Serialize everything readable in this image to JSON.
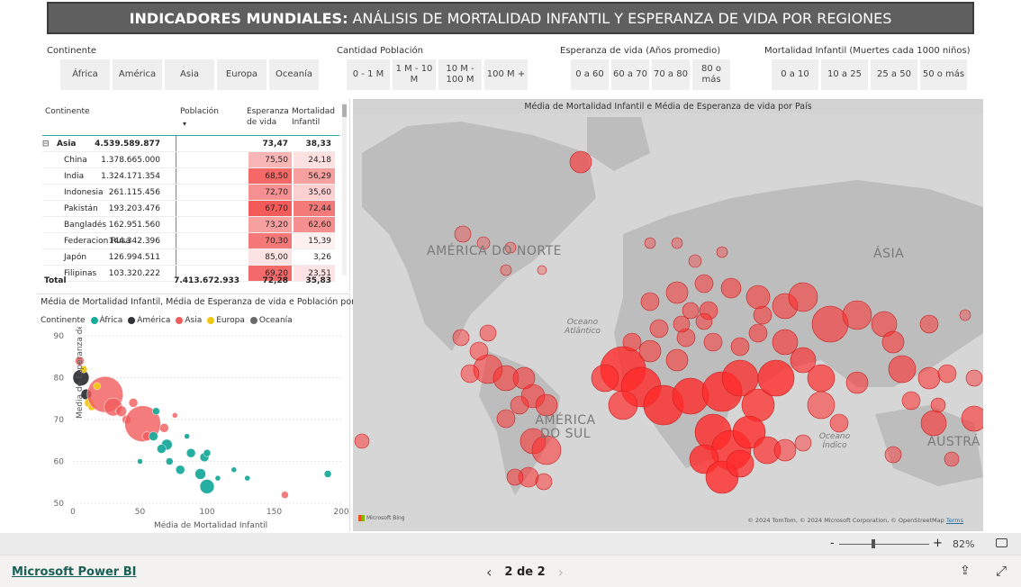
{
  "banner": {
    "bold": "INDICADORES MUNDIALES:",
    "rest": "ANÁLISIS DE MORTALIDAD INFANTIL Y ESPERANZA DE VIDA POR REGIONES"
  },
  "slicers": {
    "continente": {
      "title": "Continente",
      "options": [
        "África",
        "América",
        "Asia",
        "Europa",
        "Oceanía"
      ]
    },
    "poblacion": {
      "title": "Cantidad Población",
      "options": [
        "0 - 1 M",
        "1 M - 10 M",
        "10 M - 100 M",
        "100 M +"
      ]
    },
    "esperanza": {
      "title": "Esperanza de vida (Años promedio)",
      "options": [
        "0 a 60",
        "60 a 70",
        "70 a 80",
        "80 o más"
      ]
    },
    "mortalidad": {
      "title": "Mortalidad Infantil (Muertes cada 1000 niños)",
      "options": [
        "0 a 10",
        "10 a 25",
        "25 a 50",
        "50 o más"
      ]
    }
  },
  "table": {
    "headers": {
      "continente": "Continente",
      "poblacion": "Población",
      "esperanza": "Esperanza de vida",
      "mortalidad": "Mortalidad Infantil"
    },
    "group": {
      "expand": "⊟",
      "name": "Asia",
      "poblacion": "4.539.589.877",
      "esperanza": "73,47",
      "mortalidad": "38,33"
    },
    "rows": [
      {
        "pais": "China",
        "poblacion": "1.378.665.000",
        "esperanza": "75,50",
        "mortalidad": "24,18"
      },
      {
        "pais": "India",
        "poblacion": "1.324.171.354",
        "esperanza": "68,50",
        "mortalidad": "56,29"
      },
      {
        "pais": "Indonesia",
        "poblacion": "261.115.456",
        "esperanza": "72,70",
        "mortalidad": "35,60"
      },
      {
        "pais": "Pakistán",
        "poblacion": "193.203.476",
        "esperanza": "67,70",
        "mortalidad": "72,44"
      },
      {
        "pais": "Bangladés",
        "poblacion": "162.951.560",
        "esperanza": "73,20",
        "mortalidad": "62,60"
      },
      {
        "pais": "Federacion Rusa",
        "poblacion": "144.342.396",
        "esperanza": "70,30",
        "mortalidad": "15,39"
      },
      {
        "pais": "Japón",
        "poblacion": "126.994.511",
        "esperanza": "85,00",
        "mortalidad": "3,26"
      },
      {
        "pais": "Filipinas",
        "poblacion": "103.320.222",
        "esperanza": "69,20",
        "mortalidad": "23,51"
      }
    ],
    "total": {
      "label": "Total",
      "poblacion": "7.413.672.933",
      "esperanza": "72,28",
      "mortalidad": "35,83"
    }
  },
  "scatter": {
    "title": "Média de Mortalidad Infantil, Média de Esperanza de vida e Población por P...",
    "legend_title": "Continente",
    "legend": [
      {
        "name": "África",
        "color": "#1aab9b"
      },
      {
        "name": "América",
        "color": "#2f3436"
      },
      {
        "name": "Asia",
        "color": "#f25b5b"
      },
      {
        "name": "Europa",
        "color": "#f2c811"
      },
      {
        "name": "Oceanía",
        "color": "#6a6a6a"
      }
    ],
    "xlabel": "Média de Mortalidad Infantil",
    "ylabel": "Media de Esperanza de vida",
    "xticks": [
      "0",
      "50",
      "100",
      "150",
      "200"
    ],
    "yticks": [
      "90",
      "80",
      "70",
      "60",
      "50"
    ]
  },
  "map": {
    "title": "Média de Mortalidad Infantil e Média de Esperanza de vida por País",
    "labels": {
      "north_america": "AMÉRICA DO NORTE",
      "south_america": "AMÉRICA DO SUL",
      "asia": "ÁSIA",
      "australia": "AUSTRÁ",
      "atlantic": "Oceano Atlântico",
      "indian": "Oceano Índico"
    },
    "attribution": "© 2024 TomTom, © 2024 Microsoft Corporation, © OpenStreetMap",
    "terms": "Terms",
    "bing": "Microsoft Bing"
  },
  "zoom": {
    "minus": "-",
    "plus": "+",
    "level": "82%"
  },
  "footer": {
    "brand": "Microsoft Power BI",
    "page": "2 de 2"
  }
}
